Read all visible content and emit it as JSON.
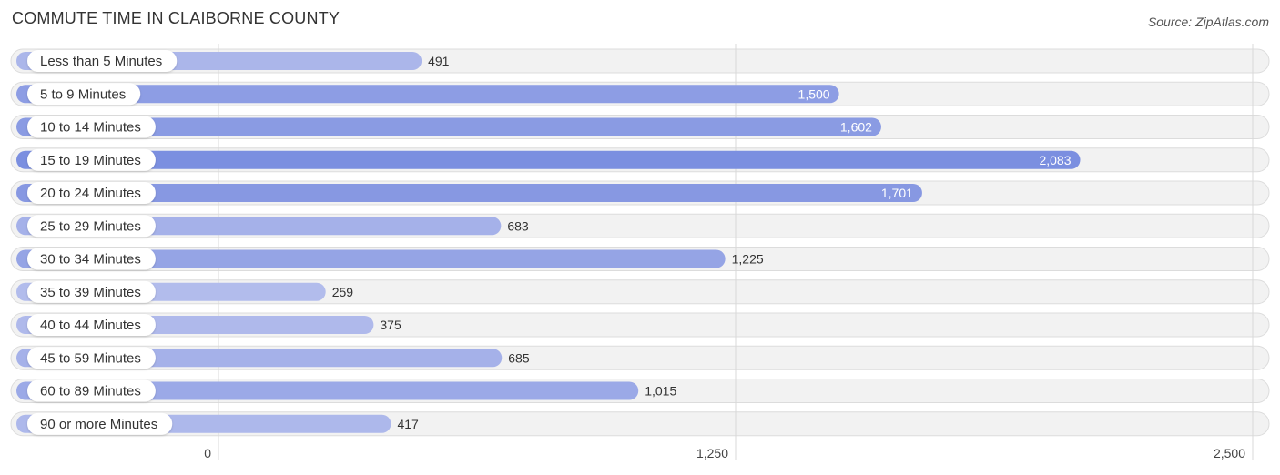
{
  "header": {
    "title": "COMMUTE TIME IN CLAIBORNE COUNTY",
    "source": "Source: ZipAtlas.com"
  },
  "chart_data": {
    "type": "bar",
    "orientation": "horizontal",
    "title": "COMMUTE TIME IN CLAIBORNE COUNTY",
    "categories": [
      "Less than 5 Minutes",
      "5 to 9 Minutes",
      "10 to 14 Minutes",
      "15 to 19 Minutes",
      "20 to 24 Minutes",
      "25 to 29 Minutes",
      "30 to 34 Minutes",
      "35 to 39 Minutes",
      "40 to 44 Minutes",
      "45 to 59 Minutes",
      "60 to 89 Minutes",
      "90 or more Minutes"
    ],
    "values": [
      491,
      1500,
      1602,
      2083,
      1701,
      683,
      1225,
      259,
      375,
      685,
      1015,
      417
    ],
    "value_labels": [
      "491",
      "1,500",
      "1,602",
      "2,083",
      "1,701",
      "683",
      "1,225",
      "259",
      "375",
      "685",
      "1,015",
      "417"
    ],
    "xlim": [
      0,
      2500
    ],
    "xticks": [
      0,
      1250,
      2500
    ],
    "xtick_labels": [
      "0",
      "1,250",
      "2,500"
    ],
    "grid": true,
    "xlabel": "",
    "ylabel": "",
    "colors": {
      "bar_low": "#b4bdec",
      "bar_high": "#7b8fe0",
      "track": "#f2f2f2",
      "label_inside": "#ffffff",
      "label_outside": "#333333"
    }
  }
}
